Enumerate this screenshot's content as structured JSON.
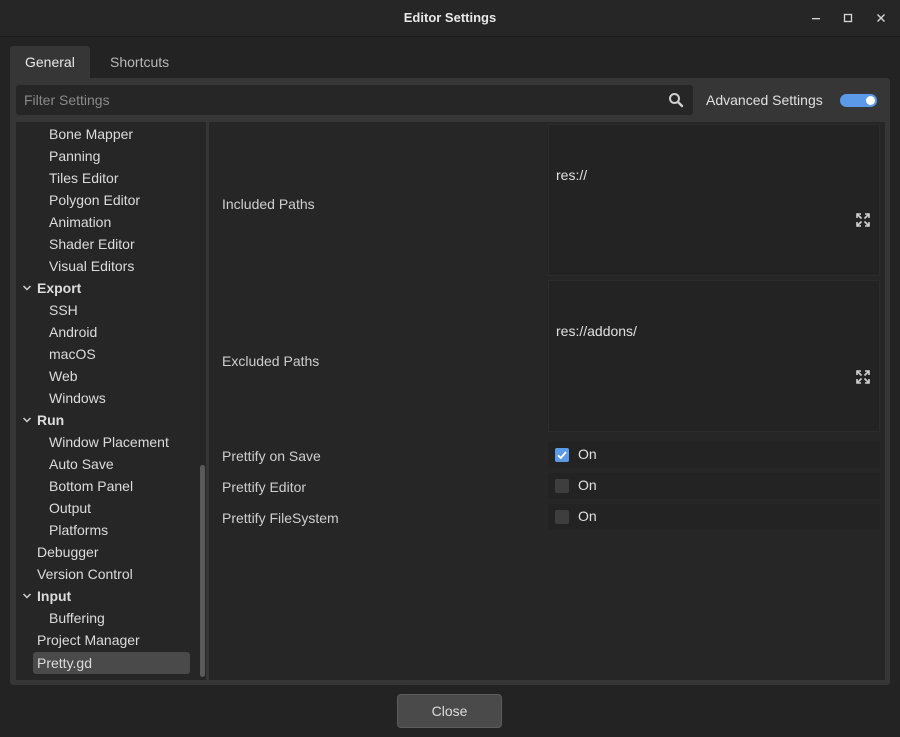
{
  "window": {
    "title": "Editor Settings",
    "controls": {
      "minimize": "–",
      "maximize": "□",
      "close": "✕"
    }
  },
  "tabs": [
    {
      "label": "General",
      "active": true
    },
    {
      "label": "Shortcuts",
      "active": false
    }
  ],
  "filter": {
    "placeholder": "Filter Settings",
    "icon": "search-icon"
  },
  "advanced": {
    "label": "Advanced Settings",
    "enabled": true
  },
  "tree": {
    "items": [
      {
        "label": "Bone Mapper",
        "level": 1
      },
      {
        "label": "Panning",
        "level": 1
      },
      {
        "label": "Tiles Editor",
        "level": 1
      },
      {
        "label": "Polygon Editor",
        "level": 1
      },
      {
        "label": "Animation",
        "level": 1
      },
      {
        "label": "Shader Editor",
        "level": 1
      },
      {
        "label": "Visual Editors",
        "level": 1
      },
      {
        "label": "Export",
        "level": 0,
        "section": true,
        "expanded": true
      },
      {
        "label": "SSH",
        "level": 1
      },
      {
        "label": "Android",
        "level": 1
      },
      {
        "label": "macOS",
        "level": 1
      },
      {
        "label": "Web",
        "level": 1
      },
      {
        "label": "Windows",
        "level": 1
      },
      {
        "label": "Run",
        "level": 0,
        "section": true,
        "expanded": true
      },
      {
        "label": "Window Placement",
        "level": 1
      },
      {
        "label": "Auto Save",
        "level": 1
      },
      {
        "label": "Bottom Panel",
        "level": 1
      },
      {
        "label": "Output",
        "level": 1
      },
      {
        "label": "Platforms",
        "level": 1
      },
      {
        "label": "Debugger",
        "level": 0
      },
      {
        "label": "Version Control",
        "level": 0
      },
      {
        "label": "Input",
        "level": 0,
        "section": true,
        "expanded": true
      },
      {
        "label": "Buffering",
        "level": 1
      },
      {
        "label": "Project Manager",
        "level": 0
      },
      {
        "label": "Pretty.gd",
        "level": 0,
        "selected": true
      }
    ]
  },
  "properties": {
    "included_paths": {
      "label": "Included Paths",
      "value": "res://"
    },
    "excluded_paths": {
      "label": "Excluded Paths",
      "value": "res://addons/"
    },
    "prettify_on_save": {
      "label": "Prettify on Save",
      "checked": true,
      "value_label": "On"
    },
    "prettify_editor": {
      "label": "Prettify Editor",
      "checked": false,
      "value_label": "On"
    },
    "prettify_filesystem": {
      "label": "Prettify FileSystem",
      "checked": false,
      "value_label": "On"
    }
  },
  "footer": {
    "close_label": "Close"
  },
  "colors": {
    "accent": "#5a9ae8",
    "panel": "#363636",
    "field": "#262626"
  }
}
